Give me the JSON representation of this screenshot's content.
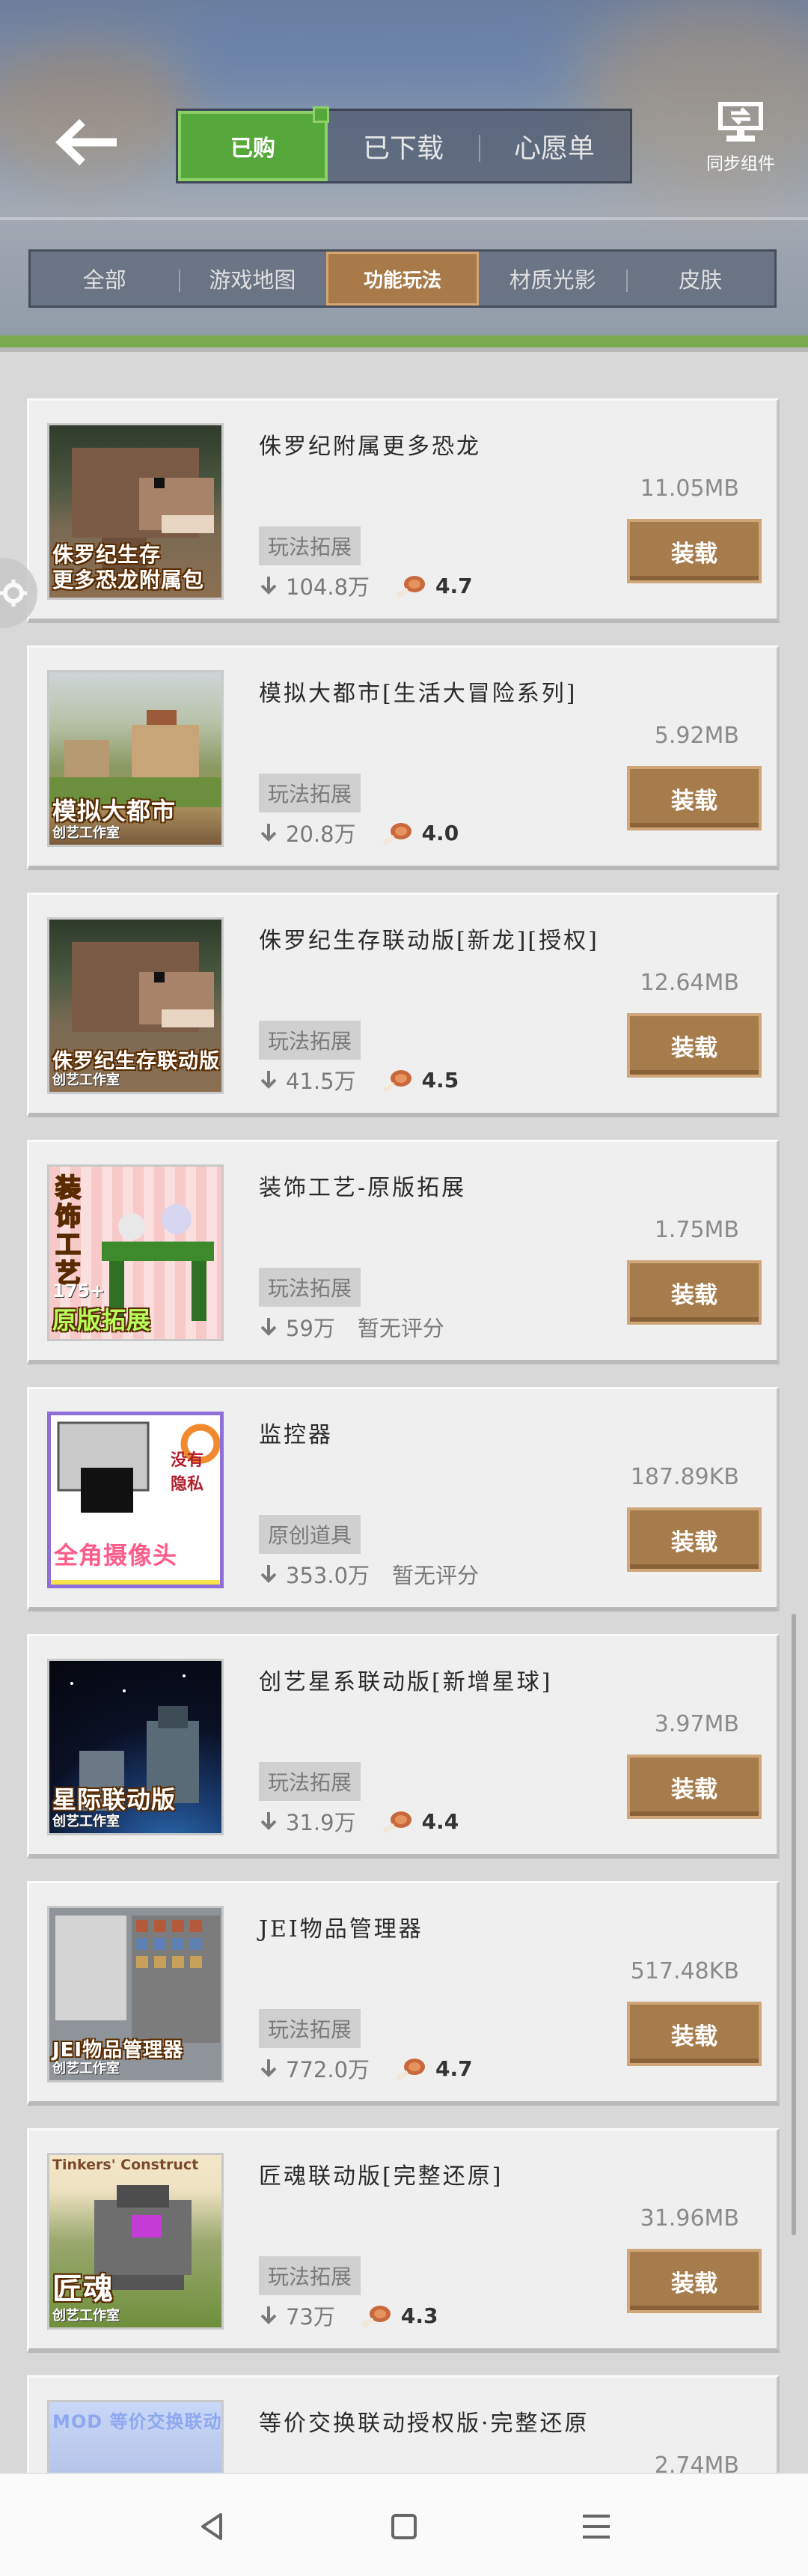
{
  "header": {
    "main_tabs": [
      {
        "label": "已购",
        "active": true
      },
      {
        "label": "已下载",
        "active": false
      },
      {
        "label": "心愿单",
        "active": false
      }
    ],
    "sync_label": "同步组件",
    "sub_tabs": [
      {
        "label": "全部",
        "active": false
      },
      {
        "label": "游戏地图",
        "active": false
      },
      {
        "label": "功能玩法",
        "active": true
      },
      {
        "label": "材质光影",
        "active": false
      },
      {
        "label": "皮肤",
        "active": false
      }
    ]
  },
  "install_label": "装载",
  "items": [
    {
      "title": "侏罗纪附属更多恐龙",
      "size": "11.05MB",
      "tag": "玩法拓展",
      "downloads": "104.8万",
      "rating": "4.7",
      "thumb_caption": "侏罗纪生存\n更多恐龙附属包",
      "thumb_sub": ""
    },
    {
      "title": "模拟大都市[生活大冒险系列]",
      "size": "5.92MB",
      "tag": "玩法拓展",
      "downloads": "20.8万",
      "rating": "4.0",
      "thumb_caption": "模拟大都市",
      "thumb_sub": "创艺工作室"
    },
    {
      "title": "侏罗纪生存联动版[新龙][授权]",
      "size": "12.64MB",
      "tag": "玩法拓展",
      "downloads": "41.5万",
      "rating": "4.5",
      "thumb_caption": "侏罗纪生存联动版",
      "thumb_sub": "创艺工作室"
    },
    {
      "title": "装饰工艺-原版拓展",
      "size": "1.75MB",
      "tag": "玩法拓展",
      "downloads": "59万",
      "rating": "暂无评分",
      "thumb_caption": "原版拓展",
      "thumb_sub": "175+"
    },
    {
      "title": "监控器",
      "size": "187.89KB",
      "tag": "原创道具",
      "downloads": "353.0万",
      "rating": "暂无评分",
      "thumb_caption": "全角摄像头",
      "thumb_sub": "没有隐私"
    },
    {
      "title": "创艺星系联动版[新增星球]",
      "size": "3.97MB",
      "tag": "玩法拓展",
      "downloads": "31.9万",
      "rating": "4.4",
      "thumb_caption": "星际联动版",
      "thumb_sub": "创艺工作室"
    },
    {
      "title": "JEI物品管理器",
      "size": "517.48KB",
      "tag": "玩法拓展",
      "downloads": "772.0万",
      "rating": "4.7",
      "thumb_caption": "JEI物品管理器",
      "thumb_sub": "创艺工作室"
    },
    {
      "title": "匠魂联动版[完整还原]",
      "size": "31.96MB",
      "tag": "玩法拓展",
      "downloads": "73万",
      "rating": "4.3",
      "thumb_caption": "匠魂",
      "thumb_sub": "创艺工作室",
      "thumb_top": "Tinkers' Construct"
    },
    {
      "title": "等价交换联动授权版·完整还原",
      "size": "2.74MB",
      "tag": "",
      "downloads": "",
      "rating": "",
      "thumb_caption": "MOD 等价交换联动版",
      "thumb_sub": ""
    }
  ]
}
